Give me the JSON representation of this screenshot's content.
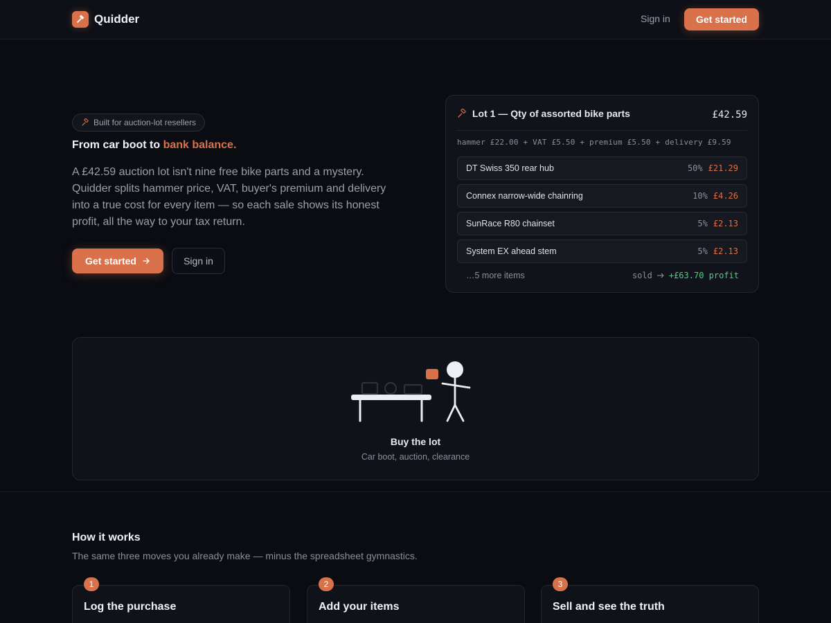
{
  "header": {
    "brand": "Quidder",
    "signin_label": "Sign in",
    "cta_label": "Get started"
  },
  "hero": {
    "pill": "Built for auction-lot resellers",
    "title_main": "From car boot to ",
    "title_accent": "bank balance.",
    "description": "A £42.59 auction lot isn't nine free bike parts and a mystery. Quidder splits hammer price, VAT, buyer's premium and delivery into a true cost for every item — so each sale shows its honest profit, all the way to your tax return.",
    "primary_button": "Get started",
    "secondary_button": "Sign in"
  },
  "lot": {
    "title": "Lot 1 — Qty of assorted bike parts",
    "total": "£42.59",
    "breakdown": "hammer £22.00 + VAT £5.50 + premium £5.50 + delivery £9.59",
    "items": [
      {
        "name": "DT Swiss 350 rear hub",
        "pct": "50%",
        "cost": "£21.29"
      },
      {
        "name": "Connex narrow-wide chainring",
        "pct": "10%",
        "cost": "£4.26"
      },
      {
        "name": "SunRace R80 chainset",
        "pct": "5%",
        "cost": "£2.13"
      },
      {
        "name": "System EX ahead stem",
        "pct": "5%",
        "cost": "£2.13"
      }
    ],
    "more": "…5 more items",
    "sold_label": "sold",
    "profit": "+£63.70 profit"
  },
  "illustration": {
    "title": "Buy the lot",
    "subtitle": "Car boot, auction, clearance"
  },
  "how": {
    "title": "How it works",
    "subtitle": "The same three moves you already make — minus the spreadsheet gymnastics.",
    "steps": [
      {
        "num": "1",
        "title": "Log the purchase"
      },
      {
        "num": "2",
        "title": "Add your items"
      },
      {
        "num": "3",
        "title": "Sell and see the truth"
      }
    ]
  },
  "colors": {
    "accent": "#d9714a",
    "profit": "#4ecf86",
    "background": "#0a0c12"
  }
}
